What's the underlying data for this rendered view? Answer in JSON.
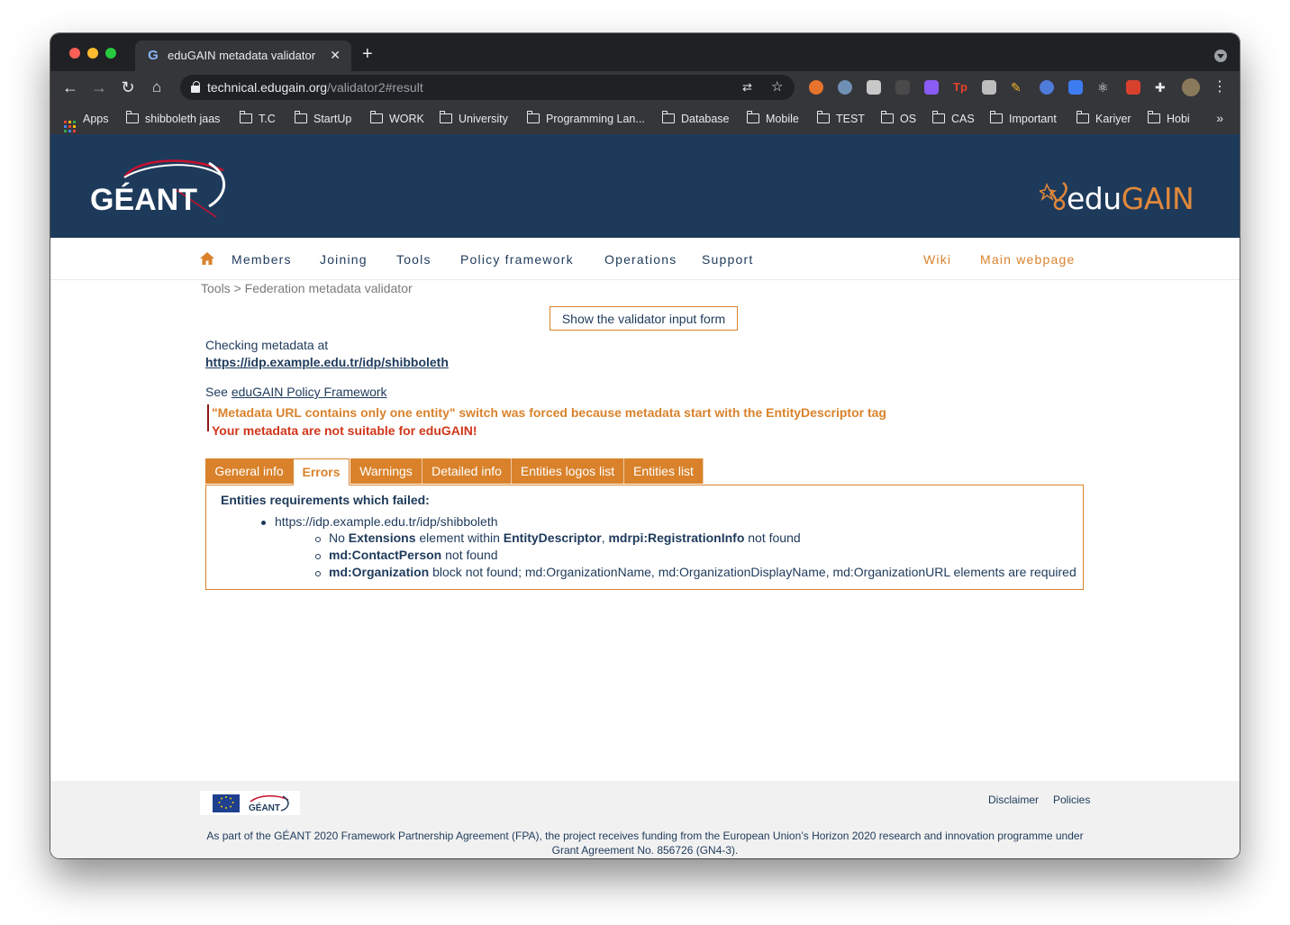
{
  "browser": {
    "tab_title": "eduGAIN metadata validator",
    "tab_favicon": "G",
    "url_host": "technical.edugain.org",
    "url_path": "/validator2#result"
  },
  "bookmarks": {
    "apps": "Apps",
    "items": [
      "shibboleth jaas",
      "T.C",
      "StartUp",
      "WORK",
      "University",
      "Programming Lan...",
      "Database",
      "Mobile",
      "TEST",
      "OS",
      "CAS",
      "Important",
      "Kariyer",
      "Hobi"
    ],
    "more": "»"
  },
  "header": {
    "geant_logo_text": "GÉANT",
    "edugain_edu": "edu",
    "edugain_gain": "GAIN"
  },
  "nav": {
    "left": [
      "Members",
      "Joining",
      "Tools",
      "Policy framework",
      "Operations",
      "Support"
    ],
    "right": [
      "Wiki",
      "Main webpage"
    ]
  },
  "breadcrumb": "Tools > Federation metadata validator",
  "show_form_button": "Show the validator input form",
  "checking_label": "Checking metadata at",
  "checking_url": "https://idp.example.edu.tr/idp/shibboleth",
  "see_prefix": "See ",
  "see_link": "eduGAIN Policy Framework",
  "message_warning": "\"Metadata URL contains only one entity\" switch was forced because metadata start with the EntityDescriptor tag",
  "message_error": "Your metadata are not suitable for eduGAIN!",
  "tabs": [
    "General info",
    "Errors",
    "Warnings",
    "Detailed info",
    "Entities logos list",
    "Entities list"
  ],
  "active_tab": "Errors",
  "panel": {
    "title": "Entities requirements which failed:",
    "entity": "https://idp.example.edu.tr/idp/shibboleth",
    "errors": [
      {
        "parts": [
          "No ",
          "Extensions",
          " element within ",
          "EntityDescriptor",
          ", ",
          "mdrpi:RegistrationInfo",
          " not found"
        ]
      },
      {
        "parts": [
          "md:ContactPerson",
          " not found"
        ]
      },
      {
        "parts": [
          "md:Organization",
          " block not found; md:OrganizationName, md:OrganizationDisplayName, md:OrganizationURL elements are required"
        ]
      }
    ]
  },
  "footer": {
    "links": [
      "Disclaimer",
      "Policies"
    ],
    "logo_text": "GÉANT",
    "text_line1": "As part of the GÉANT 2020 Framework Partnership Agreement (FPA), the project receives funding from the European Union’s Horizon 2020 research and innovation programme under",
    "text_line2": "Grant Agreement No. 856726 (GN4-3)."
  },
  "colors": {
    "banner": "#1e3a5b",
    "accent": "#d9822b",
    "error": "#d0361a"
  }
}
